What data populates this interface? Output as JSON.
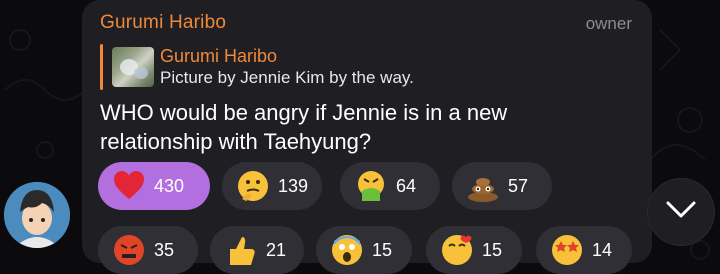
{
  "message": {
    "sender": "Gurumi Haribo",
    "role_badge": "owner",
    "reply": {
      "author": "Gurumi Haribo",
      "text": "Picture by Jennie Kim by the way."
    },
    "text": "WHO would be angry if Jennie is in a new relationship with Taehyung?"
  },
  "reactions": [
    {
      "icon": "red-heart-icon",
      "count": "430",
      "selected": true
    },
    {
      "icon": "thinking-face-icon",
      "count": "139"
    },
    {
      "icon": "vomiting-face-icon",
      "count": "64"
    },
    {
      "icon": "pile-of-poo-icon",
      "count": "57"
    },
    {
      "icon": "angry-face-icon",
      "count": "35"
    },
    {
      "icon": "thumbs-up-icon",
      "count": "21"
    },
    {
      "icon": "screaming-face-icon",
      "count": "15"
    },
    {
      "icon": "face-blowing-kiss-icon",
      "count": "15"
    },
    {
      "icon": "star-struck-icon",
      "count": "14"
    }
  ],
  "colors": {
    "accent": "#f0883a",
    "selected_reaction": "#b36ee0",
    "bubble": "#1f1e22",
    "background": "#0b0a0c"
  }
}
